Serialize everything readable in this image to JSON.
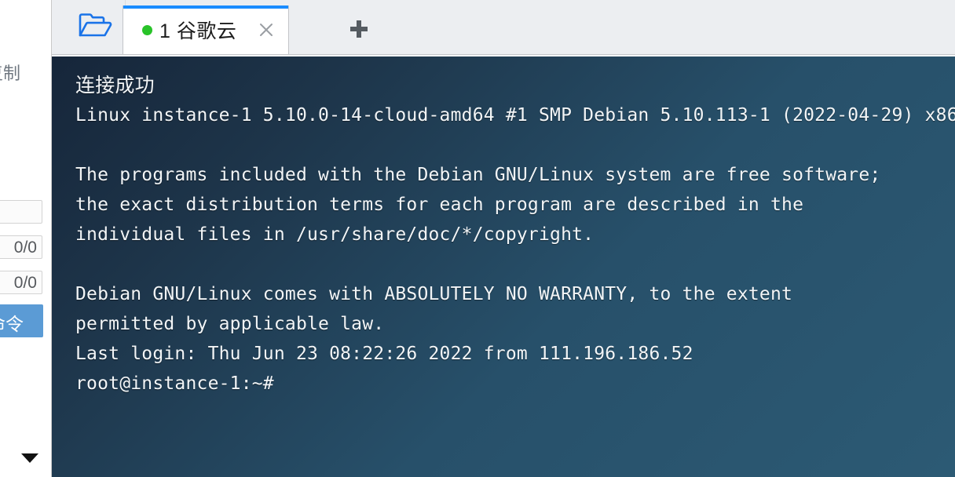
{
  "sidebar": {
    "copy_label": "复制",
    "fields": [
      {
        "name": "input-blank",
        "value": ""
      },
      {
        "name": "counter-1",
        "value": "0/0"
      },
      {
        "name": "counter-2",
        "value": "0/0"
      }
    ],
    "send_button_label": "发送命令",
    "caret_icon": "triangle-down-icon"
  },
  "tabbar": {
    "folder_icon": "open-folder-icon",
    "new_tab_icon": "plus-icon",
    "tabs": [
      {
        "title": "1 谷歌云",
        "status": "connected",
        "status_color": "#29c329",
        "active": true,
        "accent_color": "#1a8cff",
        "close_icon": "close-icon"
      }
    ]
  },
  "terminal": {
    "background_from": "#16263a",
    "background_to": "#2c5a74",
    "text_color": "#f2f5f7",
    "lines": [
      "连接成功",
      "Linux instance-1 5.10.0-14-cloud-amd64 #1 SMP Debian 5.10.113-1 (2022-04-29) x86",
      "",
      "The programs included with the Debian GNU/Linux system are free software;",
      "the exact distribution terms for each program are described in the",
      "individual files in /usr/share/doc/*/copyright.",
      "",
      "Debian GNU/Linux comes with ABSOLUTELY NO WARRANTY, to the extent",
      "permitted by applicable law.",
      "Last login: Thu Jun 23 08:22:26 2022 from 111.196.186.52",
      "root@instance-1:~#"
    ]
  }
}
